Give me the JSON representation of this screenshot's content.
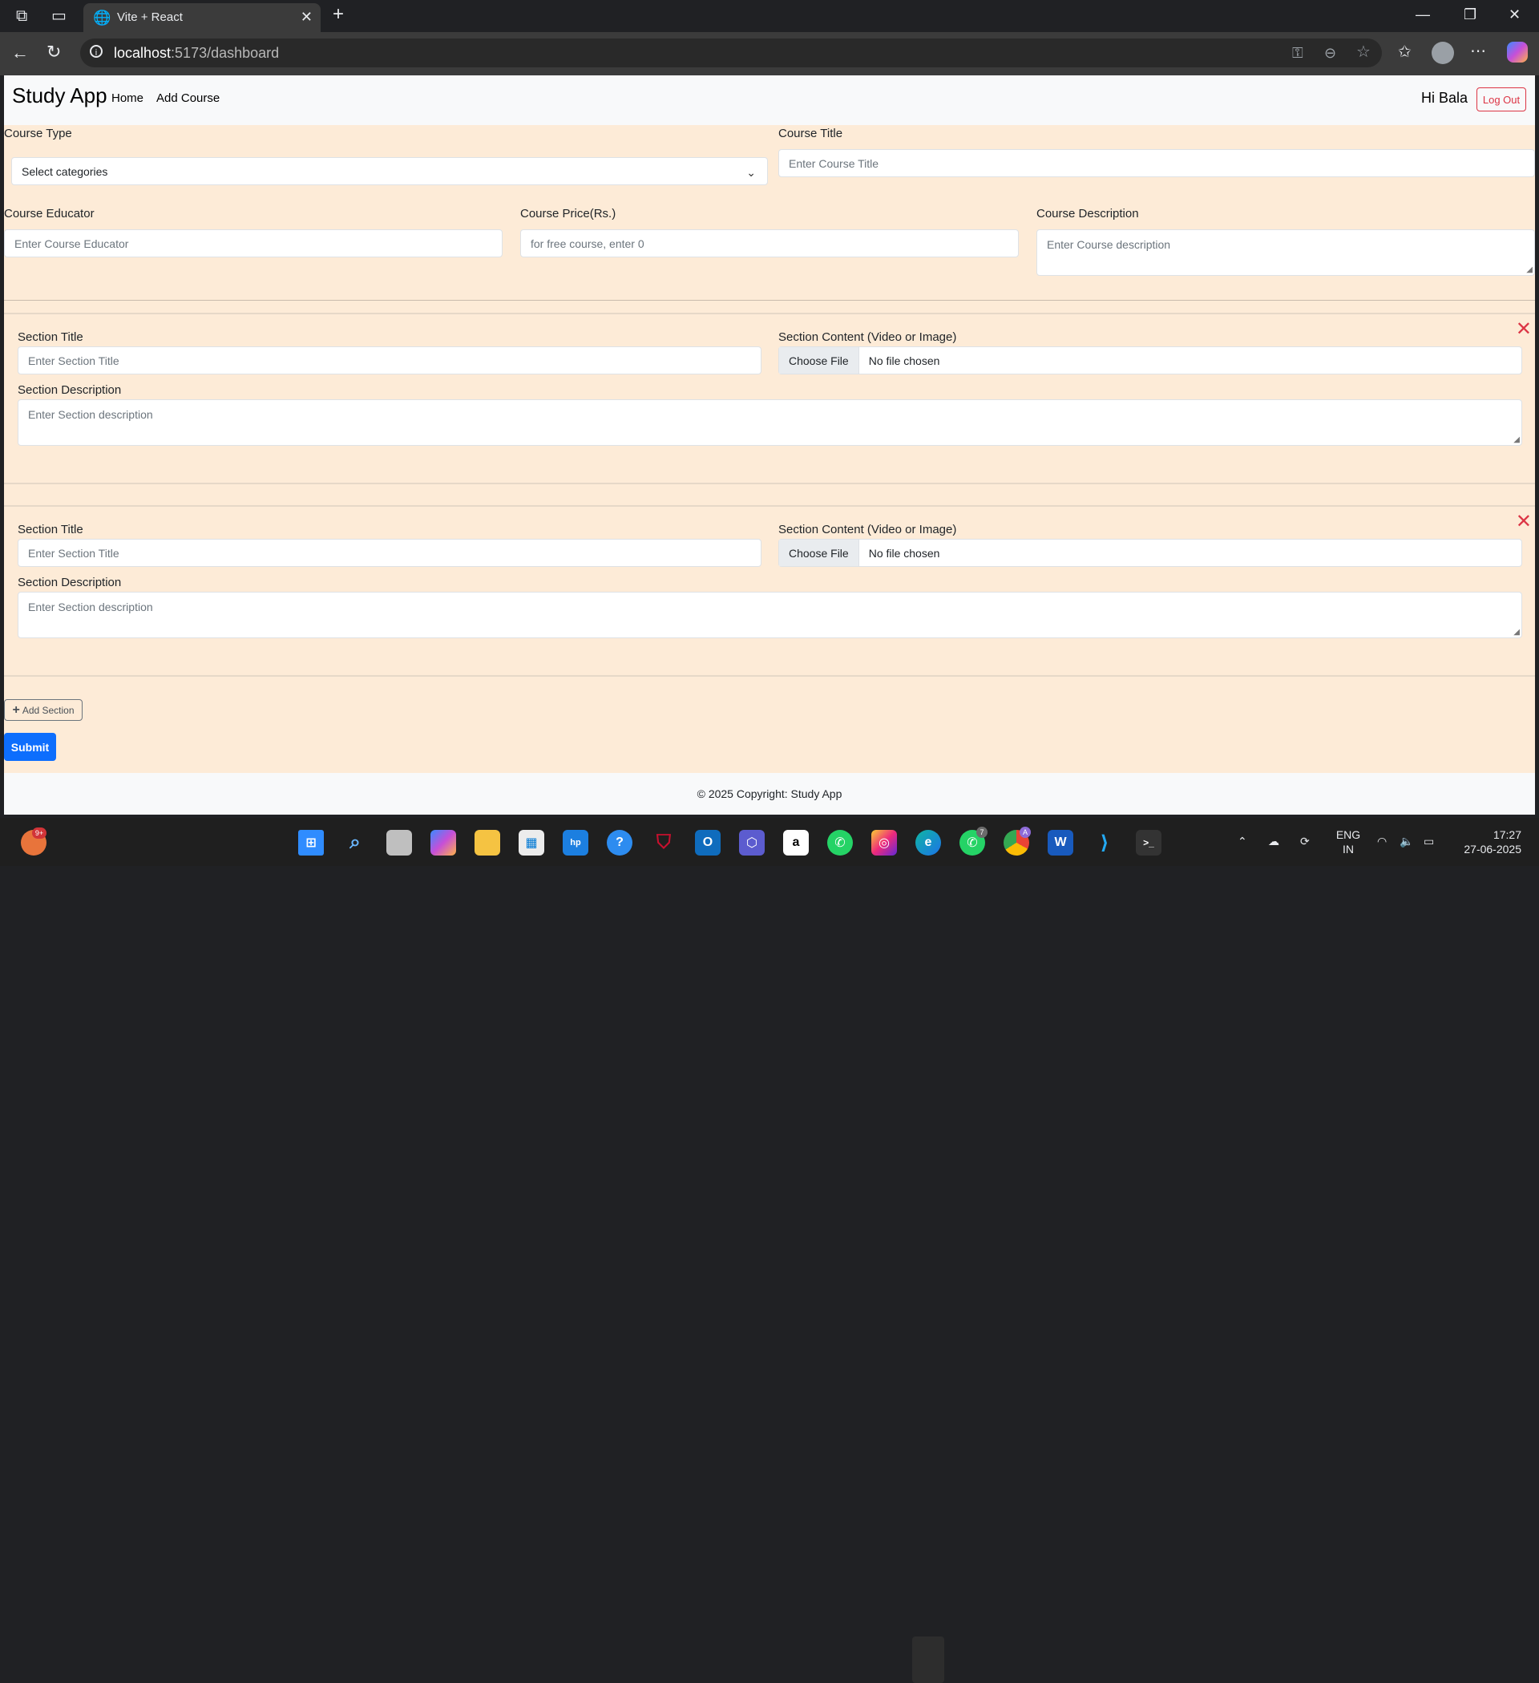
{
  "browser": {
    "tab_title": "Vite + React",
    "url_host": "localhost",
    "url_path": ":5173/dashboard"
  },
  "navbar": {
    "brand": "Study App",
    "links": [
      "Home",
      "Add Course"
    ],
    "greeting": "Hi Bala",
    "logout_label": "Log Out"
  },
  "form": {
    "course_type": {
      "label": "Course Type",
      "value": "Select categories"
    },
    "course_title": {
      "label": "Course Title",
      "placeholder": "Enter Course Title"
    },
    "course_educator": {
      "label": "Course Educator",
      "placeholder": "Enter Course Educator"
    },
    "course_price": {
      "label": "Course Price(Rs.)",
      "placeholder": "for free course, enter 0"
    },
    "course_description": {
      "label": "Course Description",
      "placeholder": "Enter Course description"
    }
  },
  "sections": [
    {
      "title_label": "Section Title",
      "title_placeholder": "Enter Section Title",
      "content_label": "Section Content (Video or Image)",
      "choose_file_label": "Choose File",
      "file_status": "No file chosen",
      "description_label": "Section Description",
      "description_placeholder": "Enter Section description"
    },
    {
      "title_label": "Section Title",
      "title_placeholder": "Enter Section Title",
      "content_label": "Section Content (Video or Image)",
      "choose_file_label": "Choose File",
      "file_status": "No file chosen",
      "description_label": "Section Description",
      "description_placeholder": "Enter Section description"
    }
  ],
  "add_section_label": "Add Section",
  "submit_label": "Submit",
  "footer": "© 2025 Copyright: Study App",
  "taskbar": {
    "lang_line1": "ENG",
    "lang_line2": "IN",
    "time": "17:27",
    "date": "27-06-2025",
    "notification_badge": "9+",
    "whatsapp_badge": "7",
    "chrome_badge": "A"
  },
  "colors": {
    "page_background": "#fdebd7",
    "primary": "#0d6efd",
    "danger": "#dc3545"
  }
}
